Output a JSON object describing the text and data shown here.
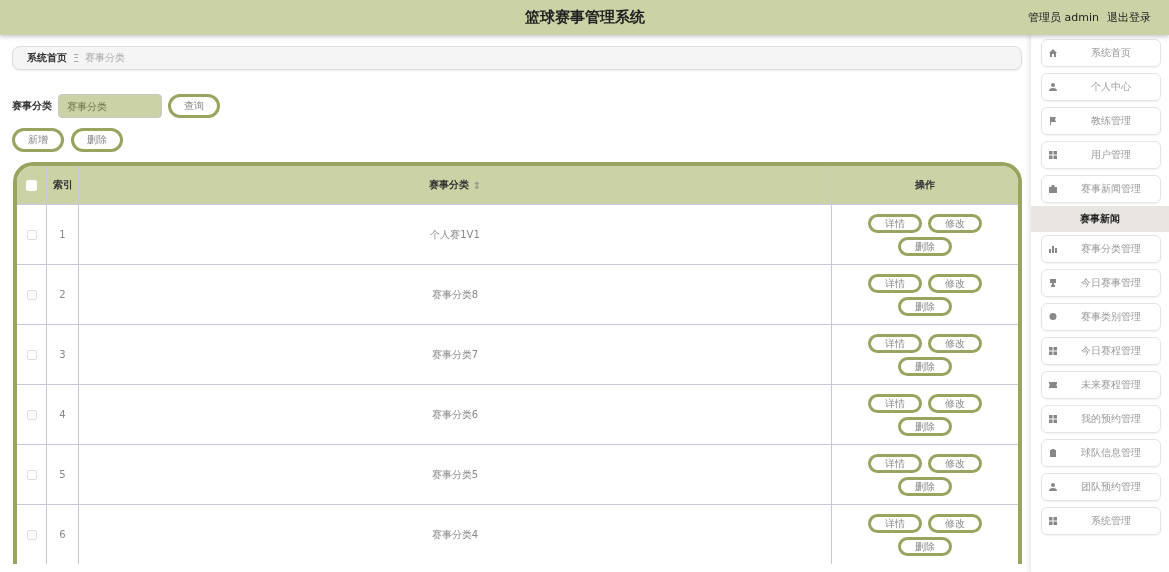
{
  "header": {
    "title": "篮球赛事管理系统",
    "user": "管理员 admin",
    "logout": "退出登录"
  },
  "breadcrumb": {
    "home": "系统首页",
    "separator": "Ξ",
    "current": "赛事分类"
  },
  "search": {
    "label": "赛事分类",
    "placeholder": "赛事分类",
    "button": "查询"
  },
  "actions": [
    "新增",
    "删除"
  ],
  "table": {
    "columns": [
      "索引",
      "赛事分类",
      "操作"
    ],
    "sort_icon": "⇕",
    "header_checked": false,
    "rows": [
      {
        "index": "1",
        "category": "个人赛1V1",
        "checked": false,
        "buttons": [
          "详情",
          "修改",
          "删除"
        ]
      },
      {
        "index": "2",
        "category": "赛事分类8",
        "checked": false,
        "buttons": [
          "详情",
          "修改",
          "删除"
        ]
      },
      {
        "index": "3",
        "category": "赛事分类7",
        "checked": false,
        "buttons": [
          "详情",
          "修改",
          "删除"
        ]
      },
      {
        "index": "4",
        "category": "赛事分类6",
        "checked": false,
        "buttons": [
          "详情",
          "修改",
          "删除"
        ]
      },
      {
        "index": "5",
        "category": "赛事分类5",
        "checked": false,
        "buttons": [
          "详情",
          "修改",
          "删除"
        ]
      },
      {
        "index": "6",
        "category": "赛事分类4",
        "checked": false,
        "buttons": [
          "详情",
          "修改",
          "删除"
        ]
      }
    ]
  },
  "sidebar": {
    "items": [
      {
        "kind": "item",
        "label": "系统首页"
      },
      {
        "kind": "item",
        "label": "个人中心"
      },
      {
        "kind": "item",
        "label": "教练管理"
      },
      {
        "kind": "item",
        "label": "用户管理"
      },
      {
        "kind": "item",
        "label": "赛事新闻管理"
      },
      {
        "kind": "sub",
        "label": "赛事新闻",
        "selected": true
      },
      {
        "kind": "item",
        "label": "赛事分类管理"
      },
      {
        "kind": "item",
        "label": "今日赛事管理"
      },
      {
        "kind": "item",
        "label": "赛事类别管理"
      },
      {
        "kind": "item",
        "label": "今日赛程管理"
      },
      {
        "kind": "item",
        "label": "未来赛程管理"
      },
      {
        "kind": "item",
        "label": "我的预约管理"
      },
      {
        "kind": "item",
        "label": "球队信息管理"
      },
      {
        "kind": "item",
        "label": "团队预约管理"
      },
      {
        "kind": "item",
        "label": "系统管理"
      }
    ]
  }
}
